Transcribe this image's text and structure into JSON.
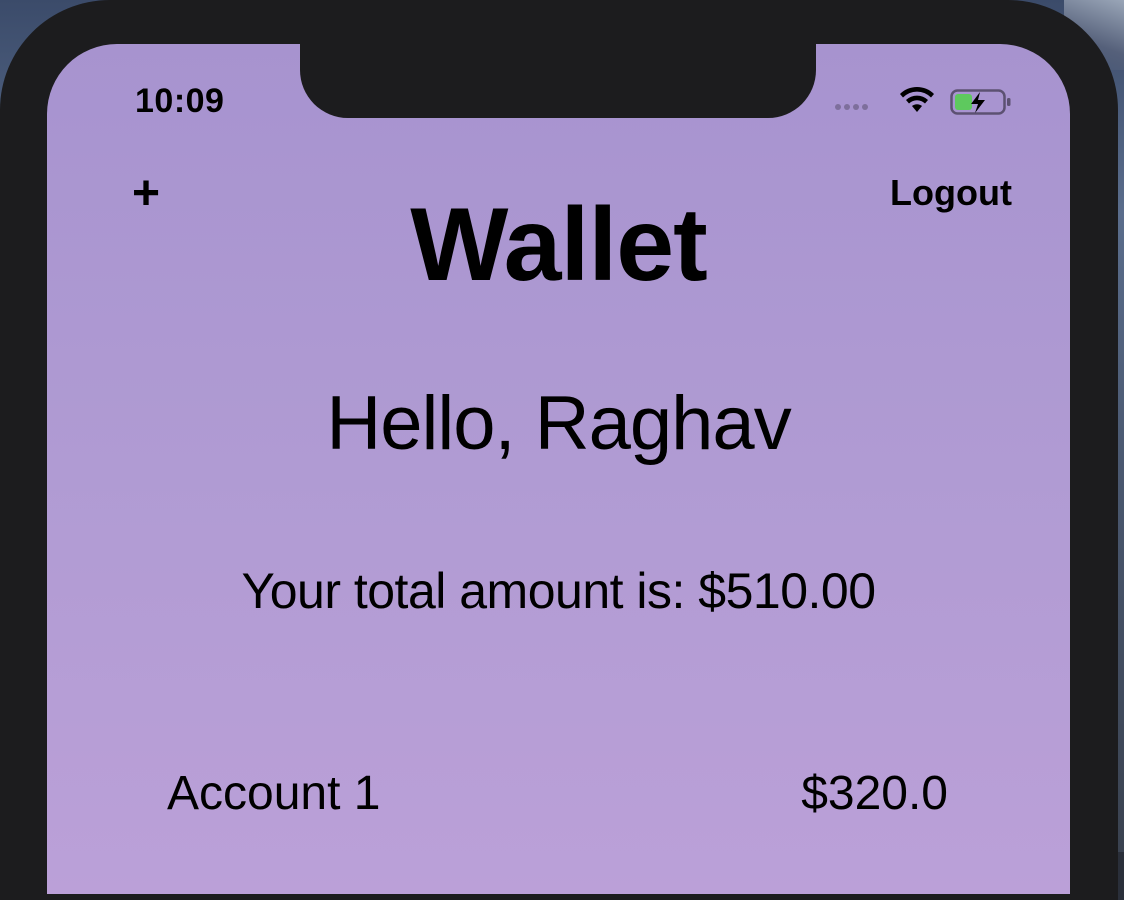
{
  "status_bar": {
    "time": "10:09",
    "icons": [
      "signal-icon",
      "wifi-icon",
      "battery-charging-icon"
    ]
  },
  "header": {
    "add_label": "+",
    "logout_label": "Logout",
    "title": "Wallet"
  },
  "greeting": "Hello, Raghav",
  "total": {
    "text": "Your total amount is: $510.00"
  },
  "accounts": [
    {
      "name": "Account 1",
      "amount": "$320.0"
    }
  ],
  "colors": {
    "screen_top": "#a793cf",
    "screen_bottom": "#bba0d8",
    "frame": "#1c1c1e",
    "battery_fill": "#5ec95e"
  }
}
